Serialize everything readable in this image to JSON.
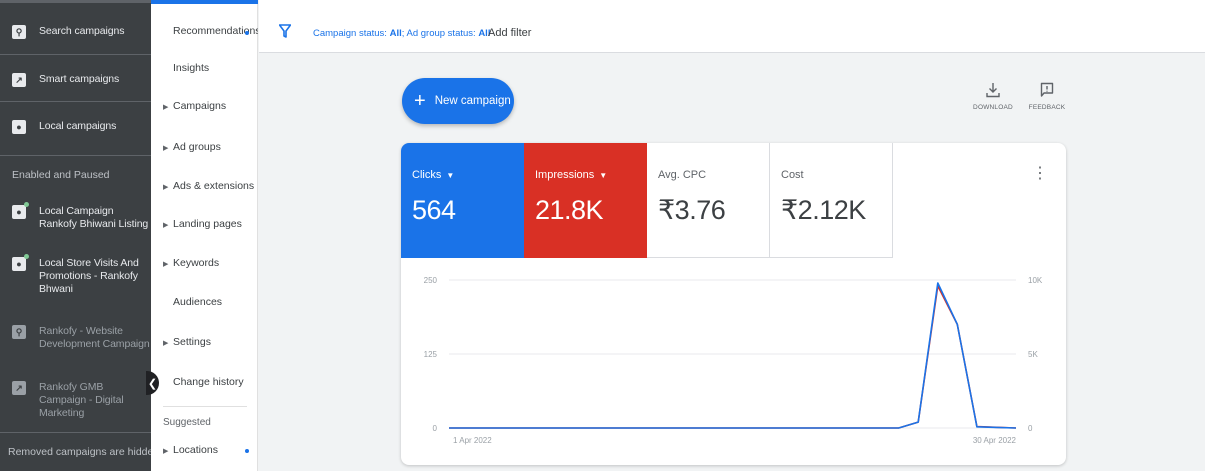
{
  "sidebar": {
    "campaign_types": [
      {
        "icon": "search-icon",
        "label": "Search campaigns"
      },
      {
        "icon": "smart-campaign-icon",
        "label": "Smart campaigns"
      },
      {
        "icon": "location-pin-icon",
        "label": "Local campaigns"
      }
    ],
    "section_label": "Enabled and Paused",
    "campaigns": [
      {
        "icon": "location-pin-icon",
        "label": "Local Campaign Rankofy Bhiwani Listing",
        "enabled": true
      },
      {
        "icon": "location-pin-icon",
        "label": "Local Store Visits And Promotions - Rankofy Bhwani",
        "enabled": true
      },
      {
        "icon": "search-icon",
        "label": "Rankofy - Website Development Campaign",
        "enabled": false
      },
      {
        "icon": "smart-campaign-icon",
        "label": "Rankofy GMB Campaign - Digital Marketing",
        "enabled": false
      }
    ],
    "footer": "Removed campaigns are hidden"
  },
  "pagenav": {
    "items": [
      {
        "label": "Recommendations",
        "arrow": false,
        "dot": true
      },
      {
        "label": "Insights",
        "arrow": false,
        "dot": false
      },
      {
        "label": "Campaigns",
        "arrow": true,
        "dot": false
      },
      {
        "label": "Ad groups",
        "arrow": true,
        "dot": false
      },
      {
        "label": "Ads & extensions",
        "arrow": true,
        "dot": false
      },
      {
        "label": "Landing pages",
        "arrow": true,
        "dot": false
      },
      {
        "label": "Keywords",
        "arrow": true,
        "dot": false
      },
      {
        "label": "Audiences",
        "arrow": false,
        "dot": false
      },
      {
        "label": "Settings",
        "arrow": true,
        "dot": false
      },
      {
        "label": "Change history",
        "arrow": false,
        "dot": false
      }
    ],
    "suggested_label": "Suggested",
    "suggested_items": [
      {
        "label": "Locations",
        "arrow": true,
        "dot": true
      }
    ]
  },
  "filterbar": {
    "campaign_status_prefix": "Campaign status: ",
    "campaign_status_value": "All",
    "separator": "; ",
    "ad_group_status_prefix": "Ad group status: ",
    "ad_group_status_value": "All",
    "add_filter_label": "Add filter"
  },
  "toolbar": {
    "new_campaign_label": "New campaign",
    "download_label": "DOWNLOAD",
    "feedback_label": "FEEDBACK"
  },
  "metrics": [
    {
      "label": "Clicks",
      "value": "564",
      "dropdown": true,
      "color": "#1a73e8"
    },
    {
      "label": "Impressions",
      "value": "21.8K",
      "dropdown": true,
      "color": "#d93025"
    },
    {
      "label": "Avg. CPC",
      "value": "₹3.76",
      "dropdown": false
    },
    {
      "label": "Cost",
      "value": "₹2.12K",
      "dropdown": false
    }
  ],
  "chart_data": {
    "type": "line",
    "x_start_label": "1 Apr 2022",
    "x_end_label": "30 Apr 2022",
    "x": [
      "1 Apr 2022",
      "2 Apr 2022",
      "3 Apr 2022",
      "4 Apr 2022",
      "5 Apr 2022",
      "6 Apr 2022",
      "7 Apr 2022",
      "8 Apr 2022",
      "9 Apr 2022",
      "10 Apr 2022",
      "11 Apr 2022",
      "12 Apr 2022",
      "13 Apr 2022",
      "14 Apr 2022",
      "15 Apr 2022",
      "16 Apr 2022",
      "17 Apr 2022",
      "18 Apr 2022",
      "19 Apr 2022",
      "20 Apr 2022",
      "21 Apr 2022",
      "22 Apr 2022",
      "23 Apr 2022",
      "24 Apr 2022",
      "25 Apr 2022",
      "26 Apr 2022",
      "27 Apr 2022",
      "28 Apr 2022",
      "29 Apr 2022",
      "30 Apr 2022"
    ],
    "left_axis": {
      "ticks": [
        "0",
        "125",
        "250"
      ],
      "range": [
        0,
        250
      ]
    },
    "right_axis": {
      "ticks": [
        "0",
        "5K",
        "10K"
      ],
      "range": [
        0,
        10000
      ]
    },
    "series": [
      {
        "name": "Clicks",
        "axis": "left",
        "color": "#1a73e8",
        "values": [
          0,
          0,
          0,
          0,
          0,
          0,
          0,
          0,
          0,
          0,
          0,
          0,
          0,
          0,
          0,
          0,
          0,
          0,
          0,
          0,
          0,
          0,
          0,
          0,
          10,
          245,
          175,
          2,
          1,
          0
        ]
      },
      {
        "name": "Impressions",
        "axis": "right",
        "color": "#d93025",
        "values": [
          0,
          0,
          0,
          0,
          0,
          0,
          0,
          0,
          0,
          0,
          0,
          0,
          0,
          0,
          0,
          0,
          0,
          0,
          0,
          0,
          0,
          0,
          0,
          0,
          400,
          9600,
          7000,
          100,
          50,
          0
        ]
      }
    ]
  }
}
